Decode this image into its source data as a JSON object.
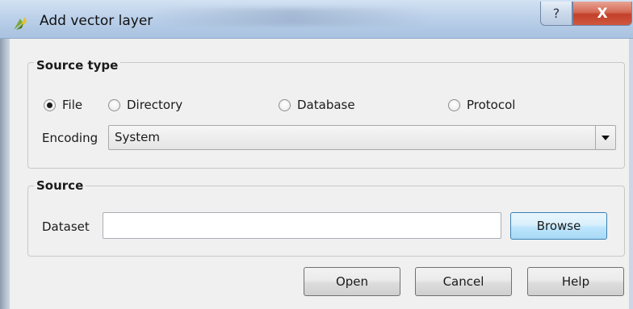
{
  "window": {
    "title": "Add vector layer",
    "help_glyph": "?",
    "close_glyph": "X"
  },
  "source_type": {
    "title": "Source type",
    "radios": [
      {
        "label": "File",
        "selected": true
      },
      {
        "label": "Directory",
        "selected": false
      },
      {
        "label": "Database",
        "selected": false
      },
      {
        "label": "Protocol",
        "selected": false
      }
    ],
    "encoding_label": "Encoding",
    "encoding_value": "System"
  },
  "source": {
    "title": "Source",
    "dataset_label": "Dataset",
    "dataset_value": "",
    "browse_label": "Browse"
  },
  "buttons": {
    "open": "Open",
    "cancel": "Cancel",
    "help": "Help"
  }
}
